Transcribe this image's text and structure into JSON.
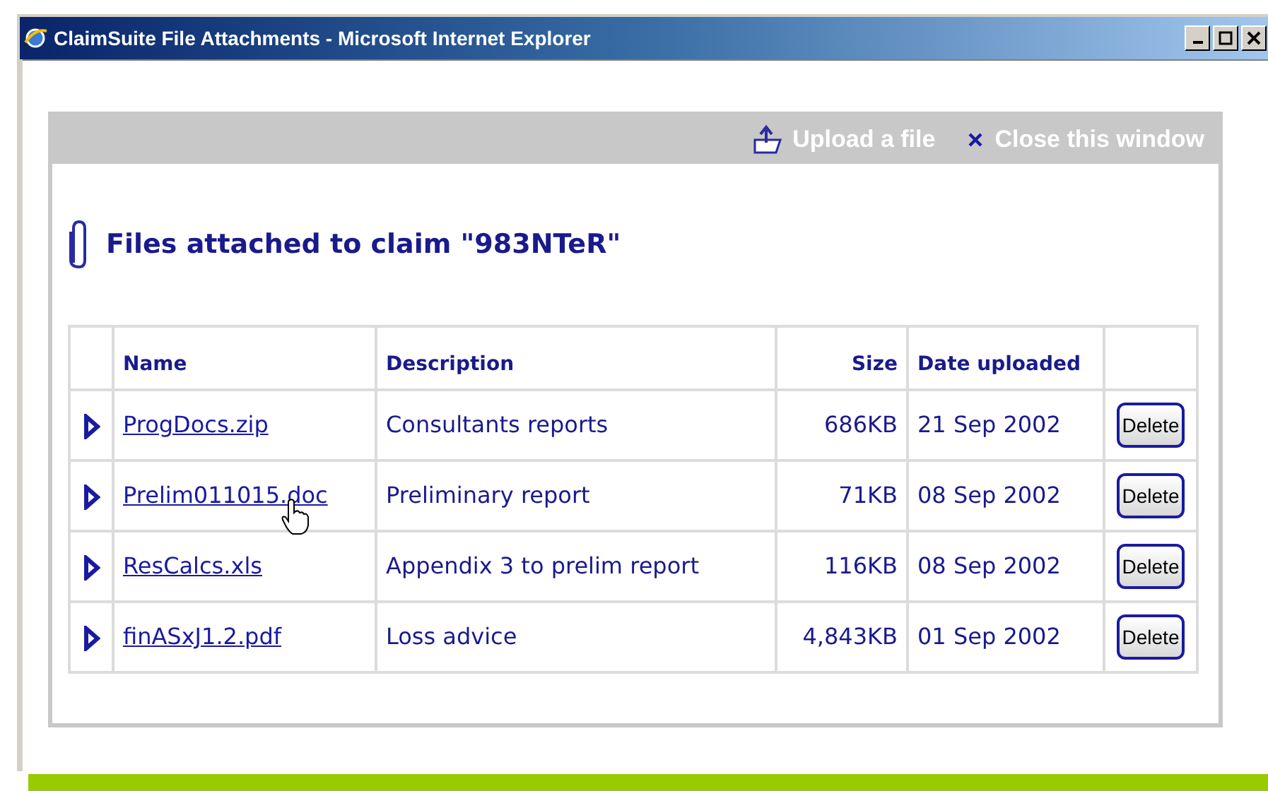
{
  "window": {
    "title": "ClaimSuite File Attachments - Microsoft Internet Explorer"
  },
  "toolbar": {
    "upload": "Upload a file",
    "close": "Close this window"
  },
  "heading": "Files attached to claim \"983NTeR\"",
  "table": {
    "columns": [
      "Name",
      "Description",
      "Size",
      "Date uploaded"
    ],
    "rows": [
      {
        "name": "ProgDocs.zip",
        "description": "Consultants reports",
        "size": "686KB",
        "date": "21 Sep 2002",
        "action": "Delete",
        "hovered": false
      },
      {
        "name": "Prelim011015.doc",
        "description": "Preliminary report",
        "size": "71KB",
        "date": "08 Sep 2002",
        "action": "Delete",
        "hovered": true
      },
      {
        "name": "ResCalcs.xls",
        "description": "Appendix 3 to prelim report",
        "size": "116KB",
        "date": "08 Sep 2002",
        "action": "Delete",
        "hovered": false
      },
      {
        "name": "finASxJ1.2.pdf",
        "description": "Loss advice",
        "size": "4,843KB",
        "date": "01 Sep 2002",
        "action": "Delete",
        "hovered": false
      }
    ]
  }
}
